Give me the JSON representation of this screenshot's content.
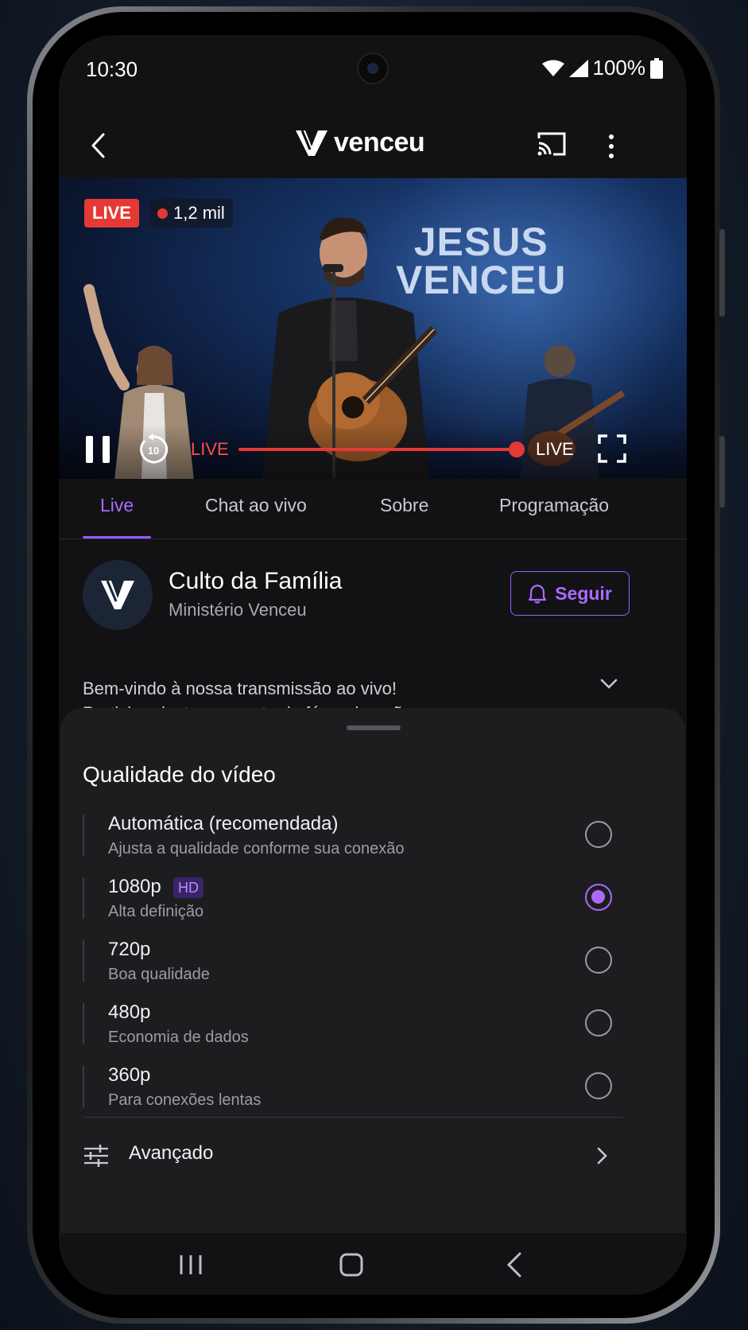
{
  "status": {
    "time": "10:30",
    "battery": "100%"
  },
  "appbar": {
    "logo_text": "venceu"
  },
  "video": {
    "live_badge": "LIVE",
    "viewers": "1,2 mil",
    "stage_text_line1": "JESUS",
    "stage_text_line2": "VENCEU",
    "live_label_left": "LIVE",
    "live_label_right": "LIVE",
    "rewind_seconds": "10",
    "progress": 1.0
  },
  "tabs": [
    {
      "label": "Live",
      "active": true
    },
    {
      "label": "Chat ao vivo",
      "active": false
    },
    {
      "label": "Sobre",
      "active": false
    },
    {
      "label": "Programação",
      "active": false
    }
  ],
  "channel": {
    "title": "Culto da Família",
    "subtitle": "Ministério Venceu",
    "follow_label": "Seguir"
  },
  "description": {
    "line1": "Bem-vindo à nossa transmissão ao vivo!",
    "line2": "Participe deste momento de fé e adoração."
  },
  "quality_sheet": {
    "title": "Qualidade do vídeo",
    "options": [
      {
        "label": "Automática (recomendada)",
        "sub": "Ajusta a qualidade conforme sua conexão",
        "selected": false
      },
      {
        "label": "1080p",
        "badge": "HD",
        "sub": "Alta definição",
        "selected": true
      },
      {
        "label": "720p",
        "sub": "Boa qualidade",
        "selected": false
      },
      {
        "label": "480p",
        "sub": "Economia de dados",
        "selected": false
      },
      {
        "label": "360p",
        "sub": "Para conexões lentas",
        "selected": false
      }
    ],
    "advanced_label": "Avançado"
  },
  "colors": {
    "accent": "#a96bff",
    "live": "#e53935",
    "background": "#121214",
    "sheet": "#1d1d20"
  }
}
